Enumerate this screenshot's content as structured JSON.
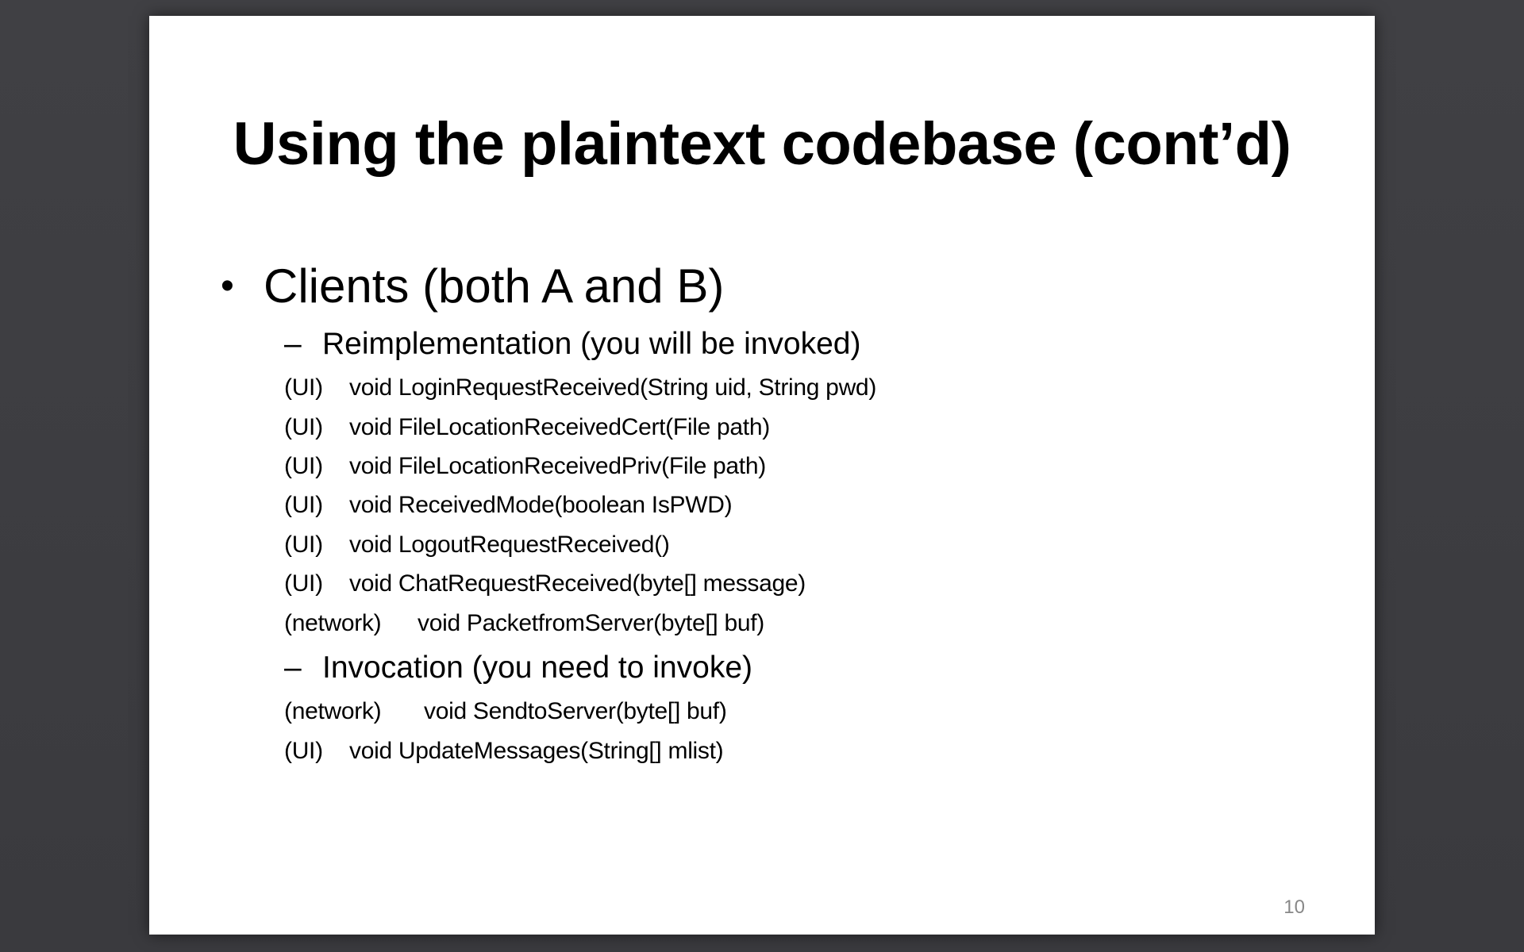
{
  "slide": {
    "title": "Using the plaintext codebase (cont’d)",
    "bullet": "Clients (both A and B)",
    "bullet_marker": "•",
    "sections": [
      {
        "heading": "Reimplementation (you will be invoked)",
        "items": [
          {
            "tag": "(UI)",
            "sig": "void LoginRequestReceived(String uid, String pwd)"
          },
          {
            "tag": "(UI)",
            "sig": "void FileLocationReceivedCert(File path)"
          },
          {
            "tag": "(UI)",
            "sig": "void FileLocationReceivedPriv(File path)"
          },
          {
            "tag": "(UI)",
            "sig": "void ReceivedMode(boolean IsPWD)"
          },
          {
            "tag": "(UI)",
            "sig": "void LogoutRequestReceived()"
          },
          {
            "tag": "(UI)",
            "sig": "void ChatRequestReceived(byte[] message)"
          },
          {
            "tag": "(network)",
            "sig": "void PacketfromServer(byte[] buf)"
          }
        ]
      },
      {
        "heading": "Invocation (you need to invoke)",
        "items": [
          {
            "tag": "(network)",
            "sig": "void SendtoServer(byte[] buf)"
          },
          {
            "tag": "(UI)",
            "sig": "void UpdateMessages(String[] mlist)"
          }
        ]
      }
    ],
    "dash": "–",
    "page_number": "10"
  },
  "colors": {
    "background": "#3f3f43",
    "slide": "#ffffff",
    "text": "#000000",
    "page_number": "#888888"
  }
}
